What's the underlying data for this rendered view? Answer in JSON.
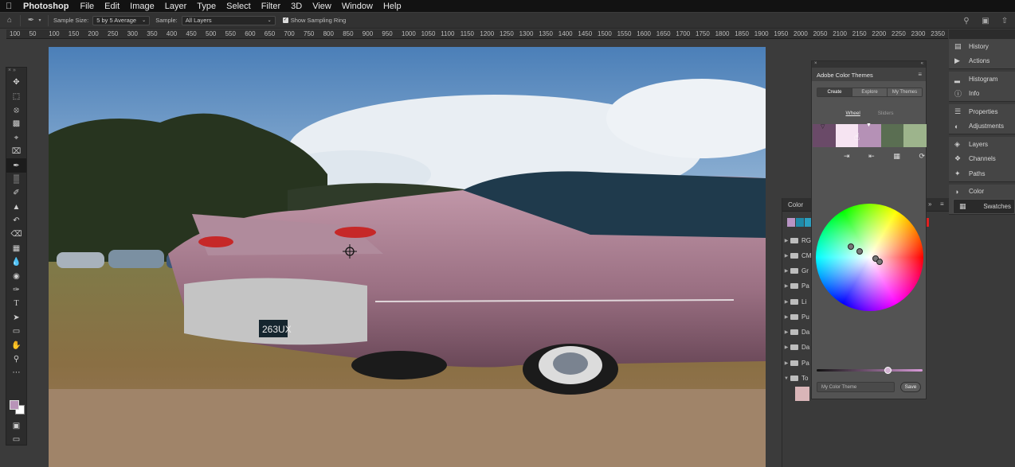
{
  "menubar": {
    "app": "Photoshop",
    "items": [
      "File",
      "Edit",
      "Image",
      "Layer",
      "Type",
      "Select",
      "Filter",
      "3D",
      "View",
      "Window",
      "Help"
    ]
  },
  "options": {
    "sample_size_label": "Sample Size:",
    "sample_size_value": "5 by 5 Average",
    "sample_label": "Sample:",
    "sample_value": "All Layers",
    "show_ring_label": "Show Sampling Ring"
  },
  "ruler": [
    "100",
    "50",
    "100",
    "150",
    "200",
    "250",
    "300",
    "350",
    "400",
    "450",
    "500",
    "550",
    "600",
    "650",
    "700",
    "750",
    "800",
    "850",
    "900",
    "950",
    "1000",
    "1050",
    "1100",
    "1150",
    "1200",
    "1250",
    "1300",
    "1350",
    "1400",
    "1450",
    "1500",
    "1550",
    "1600",
    "1650",
    "1700",
    "1750",
    "1800",
    "1850",
    "1900",
    "1950",
    "2000",
    "2050",
    "2100",
    "2150",
    "2200",
    "2250",
    "2300",
    "2350"
  ],
  "color_panel": {
    "title": "Color",
    "groups": [
      "RG",
      "CM",
      "Gr",
      "Pa",
      "Li",
      "Pu",
      "Da",
      "Da",
      "Pa",
      "To"
    ],
    "swatches": [
      "#b894c4",
      "#1f8aa8",
      "#2a9fc0"
    ]
  },
  "color_themes": {
    "title": "Adobe Color Themes",
    "tabs": [
      "Create",
      "Explore",
      "My Themes"
    ],
    "subtabs": [
      "Wheel",
      "Sliders"
    ],
    "theme_colors": [
      "#6a4a68",
      "#f6e4f2",
      "#b591b6",
      "#5a6e52",
      "#9db48c"
    ],
    "name_placeholder": "My Color Theme",
    "save_label": "Save"
  },
  "dock": {
    "groups": [
      [
        {
          "icon": "history-icon",
          "label": "History"
        },
        {
          "icon": "actions-icon",
          "label": "Actions"
        }
      ],
      [
        {
          "icon": "histogram-icon",
          "label": "Histogram"
        },
        {
          "icon": "info-icon",
          "label": "Info"
        }
      ],
      [
        {
          "icon": "properties-icon",
          "label": "Properties"
        },
        {
          "icon": "adjustments-icon",
          "label": "Adjustments"
        }
      ],
      [
        {
          "icon": "layers-icon",
          "label": "Layers"
        },
        {
          "icon": "channels-icon",
          "label": "Channels"
        },
        {
          "icon": "paths-icon",
          "label": "Paths"
        }
      ],
      [
        {
          "icon": "color-icon",
          "label": "Color"
        },
        {
          "icon": "swatches-icon",
          "label": "Swatches"
        }
      ]
    ]
  }
}
